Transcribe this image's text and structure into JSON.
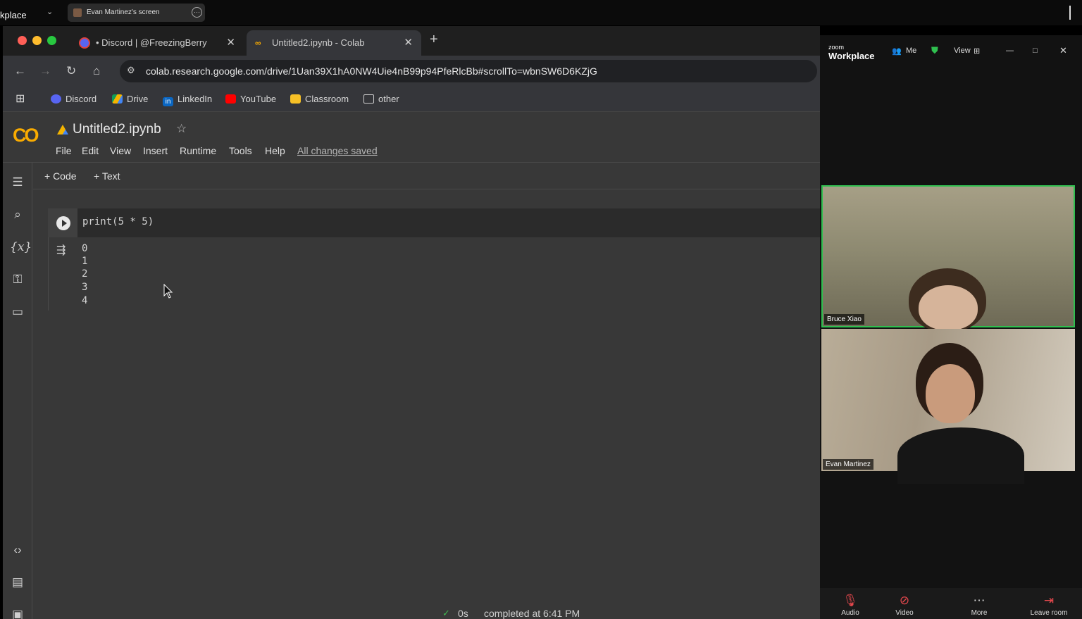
{
  "share_bar": {
    "app_partial": "kplace",
    "share_label": "Evan Martinez's screen"
  },
  "browser": {
    "tabs": [
      {
        "label": "• Discord | @FreezingBerry",
        "active": false
      },
      {
        "label": "Untitled2.ipynb - Colab",
        "active": true
      }
    ],
    "url": "colab.research.google.com/drive/1Uan39X1hA0NW4Uie4nB99p94PfeRlcBb#scrollTo=wbnSW6D6KZjG",
    "bookmarks": [
      "Discord",
      "Drive",
      "LinkedIn",
      "YouTube",
      "Classroom",
      "other"
    ]
  },
  "colab": {
    "logo": "CO",
    "notebook_title": "Untitled2.ipynb",
    "menu": [
      "File",
      "Edit",
      "View",
      "Insert",
      "Runtime",
      "Tools",
      "Help"
    ],
    "save_status": "All changes saved",
    "add_code": "+ Code",
    "add_text": "+ Text",
    "cell_code": "print(5 * 5)",
    "output_lines": [
      "0",
      "1",
      "2",
      "3",
      "4"
    ],
    "status_time": "0s",
    "status_text": "completed at 6:41 PM"
  },
  "zoom": {
    "logo_small": "zoom",
    "logo_big": "Workplace",
    "header_me": "Me",
    "header_view": "View",
    "participants": [
      {
        "name": "Bruce Xiao",
        "active_speaker": true
      },
      {
        "name": "Evan Martinez",
        "active_speaker": false
      }
    ],
    "controls": [
      "Audio",
      "Video",
      "More",
      "Leave room"
    ]
  },
  "colors": {
    "colab_bg": "#383838",
    "speaker_border": "#2fbf4f",
    "colab_orange": "#f9ab00"
  }
}
